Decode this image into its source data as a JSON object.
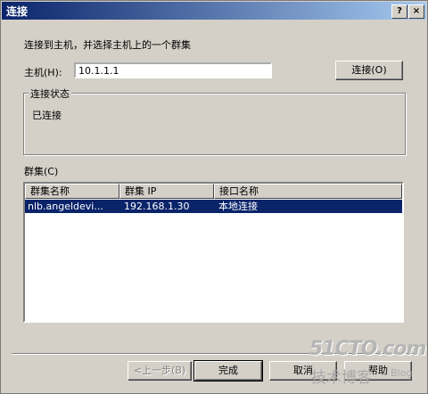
{
  "window": {
    "title": "连接",
    "help_glyph": "?",
    "close_glyph": "×"
  },
  "instruction": "连接到主机，并选择主机上的一个群集",
  "host": {
    "label": "主机(H):",
    "value": "10.1.1.1",
    "connect_button": "连接(O)"
  },
  "status": {
    "group_label": "连接状态",
    "text": "已连接"
  },
  "clusters": {
    "label": "群集(C)",
    "columns": [
      "群集名称",
      "群集 IP",
      "接口名称"
    ],
    "rows": [
      {
        "name": "nlb.angeldevi...",
        "ip": "192.168.1.30",
        "interface": "本地连接",
        "selected": true
      }
    ]
  },
  "footer": {
    "back": "<上一步(B)",
    "finish": "完成",
    "cancel": "取消",
    "help": "帮助"
  },
  "watermark": {
    "brand": "51CTO.com",
    "subtitle": "技术博客",
    "blog": "Blog"
  },
  "colors": {
    "titlebar_start": "#0a246a",
    "titlebar_end": "#a6caf0",
    "selection": "#0a246a",
    "face": "#d4d0c8"
  }
}
